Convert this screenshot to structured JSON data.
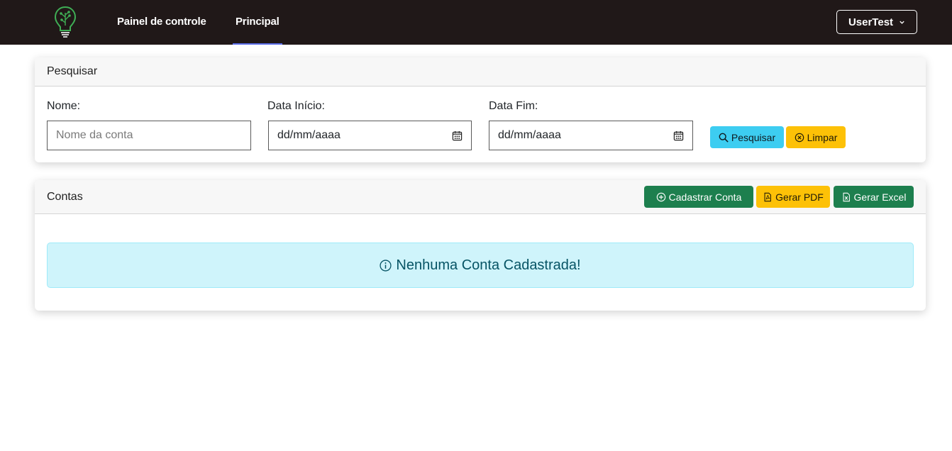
{
  "navbar": {
    "logo_icon": "lightbulb-circuit-logo",
    "links": [
      {
        "label": "Painel de controle",
        "active": false
      },
      {
        "label": "Principal",
        "active": true
      }
    ],
    "user": {
      "label": "UserTest",
      "icon": "chevron-down-icon"
    }
  },
  "search_card": {
    "title": "Pesquisar",
    "fields": {
      "nome": {
        "label": "Nome:",
        "placeholder": "Nome da conta",
        "value": ""
      },
      "data_inicio": {
        "label": "Data Início:",
        "value": "dd/mm/aaaa",
        "icon": "calendar-icon"
      },
      "data_fim": {
        "label": "Data Fim:",
        "value": "dd/mm/aaaa",
        "icon": "calendar-icon"
      }
    },
    "buttons": {
      "search": {
        "label": "Pesquisar",
        "icon": "search-icon",
        "color": "#3dcdf1"
      },
      "clear": {
        "label": "Limpar",
        "icon": "x-circle-icon",
        "color": "#fdc107"
      }
    }
  },
  "accounts_card": {
    "title": "Contas",
    "buttons": {
      "add": {
        "label": "Cadastrar Conta",
        "icon": "plus-circle-icon",
        "color": "#1d7f4e"
      },
      "pdf": {
        "label": "Gerar PDF",
        "icon": "file-pdf-icon",
        "color": "#fdc107"
      },
      "excel": {
        "label": "Gerar Excel",
        "icon": "file-excel-icon",
        "color": "#1d7f4e"
      }
    },
    "empty_message": {
      "text": "Nenhuma Conta Cadastrada!",
      "icon": "info-circle-icon"
    }
  },
  "colors": {
    "navbar_bg": "#201818",
    "active_underline": "#5b6ee8",
    "alert_bg": "#cff4fb",
    "alert_text": "#065465"
  }
}
